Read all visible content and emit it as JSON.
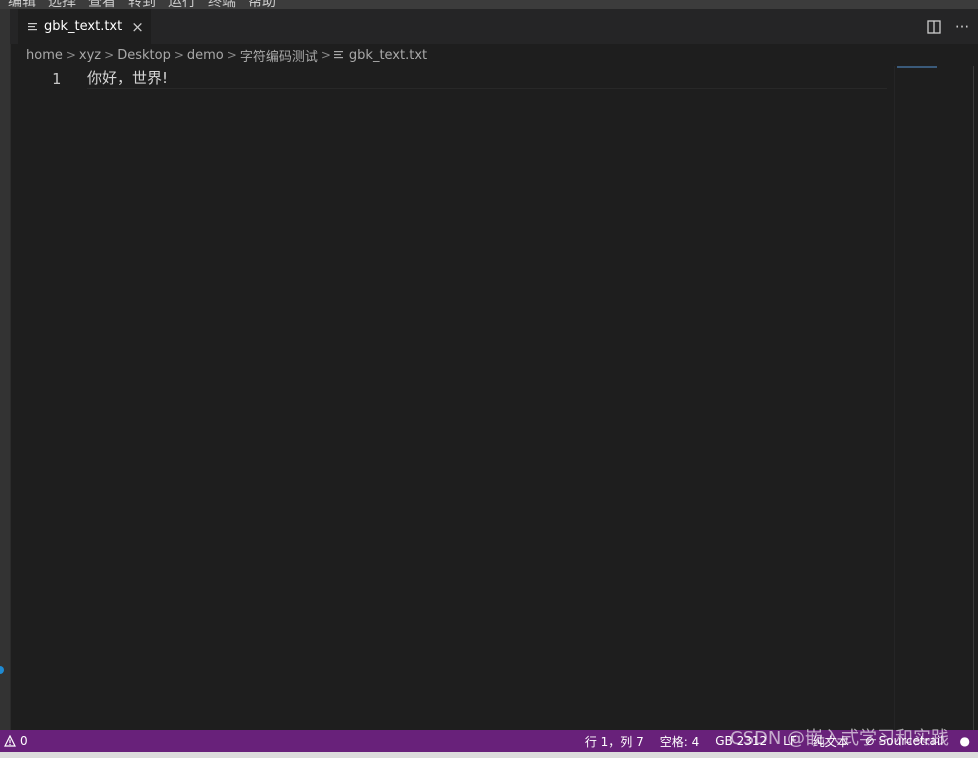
{
  "menubar": {
    "items": [
      "编辑",
      "选择",
      "查看",
      "转到",
      "运行",
      "终端",
      "帮助"
    ]
  },
  "tab": {
    "label": "gbk_text.txt",
    "close": "×",
    "file_icon": "lines-file-icon"
  },
  "tab_actions": {
    "split": "split-editor-icon",
    "more": "···"
  },
  "breadcrumb": [
    "home",
    "xyz",
    "Desktop",
    "demo",
    "字符编码测试"
  ],
  "breadcrumb_sep": ">",
  "breadcrumb_file": "gbk_text.txt",
  "editor": {
    "line_number": "1",
    "line_text": "你好，世界!"
  },
  "statusbar": {
    "problems": "0",
    "position": "行 1，列 7",
    "spaces": "空格: 4",
    "encoding": "GB 2312",
    "eol": "LF",
    "language": "纯文本",
    "extension": "Sourcetrail"
  },
  "watermark": "CSDN @嵌入式学习和实践",
  "colors": {
    "status_bg": "#68217a",
    "editor_bg": "#1e1e1e",
    "tab_bg": "#252526"
  }
}
